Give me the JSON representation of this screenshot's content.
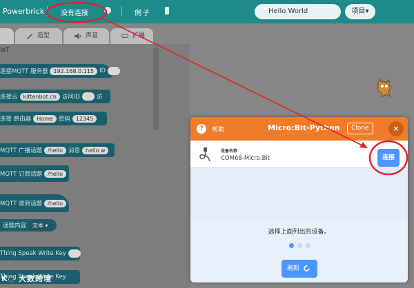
{
  "menubar": {
    "brand": "Powerbrick",
    "connection_status": "没有连接",
    "examples": "例子",
    "project_name": "Hello World",
    "project_menu": "项目"
  },
  "tabs": [
    {
      "label": ""
    },
    {
      "label": "造型"
    },
    {
      "label": "声音"
    },
    {
      "label": "扩展"
    }
  ],
  "palette": {
    "category": "IoT",
    "blocks": [
      {
        "text": "连接MQTT 服务器",
        "pill": "192.168.0.115",
        "tail": "ID"
      },
      {
        "text": "连接云",
        "pill": "kittenbot.cn",
        "tail": "访问ID",
        "tail2": "访"
      },
      {
        "text": "连接 路由器",
        "pill": "Home",
        "tail": "密码",
        "pill2": "12345"
      },
      {
        "text": "MQTT 广播话题",
        "pill": "/hello",
        "tail": "消息",
        "pill2": "hello w"
      },
      {
        "text": "MQTT 订阅话题",
        "pill": "/hello"
      },
      {
        "text": "MQTT 收到话题",
        "pill": "/hello"
      },
      {
        "text": "话题内容",
        "dd": "文本"
      },
      {
        "text": "Thing Speak Write Key"
      },
      {
        "text": "Thing Speak Write Key"
      }
    ]
  },
  "watermark": "大数跨境",
  "dialog": {
    "help_label": "帮助",
    "title": "Micro:Bit-Python",
    "clone_label": "Clone",
    "close_symbol": "×",
    "device_label": "设备名称",
    "device_name": "COM68-Micro:Bit",
    "connect_label": "连接",
    "instruction": "选择上面列出的设备。",
    "refresh_label": "刷新"
  },
  "colors": {
    "menubar": "#1f8a8a",
    "dialog_header": "#f07c2a",
    "accent_blue": "#4c97ff",
    "annotation_red": "#e3222a"
  }
}
